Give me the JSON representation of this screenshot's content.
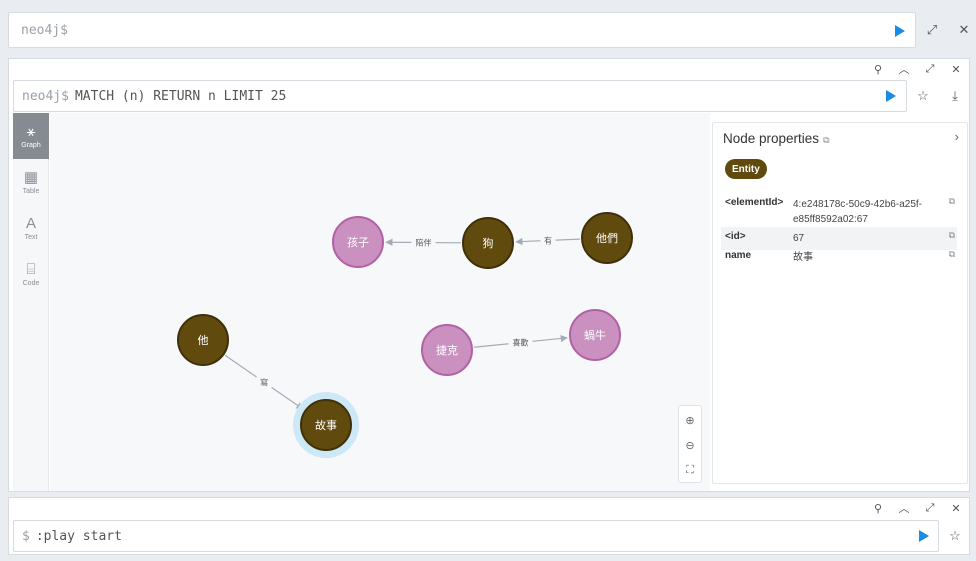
{
  "top_editor": {
    "prompt": "neo4j$",
    "query": ""
  },
  "result_frame": {
    "prompt": "neo4j$",
    "query": "MATCH (n) RETURN n LIMIT 25",
    "controls": [
      "pin-icon",
      "collapse-icon",
      "fullscreen-icon",
      "close-icon"
    ]
  },
  "sidebar": {
    "items": [
      {
        "label": "Graph",
        "icon": "graph-icon",
        "active": true
      },
      {
        "label": "Table",
        "icon": "table-icon",
        "active": false
      },
      {
        "label": "Text",
        "icon": "text-icon",
        "active": false
      },
      {
        "label": "Code",
        "icon": "code-icon",
        "active": false
      }
    ]
  },
  "graph": {
    "nodes": [
      {
        "id": "kid",
        "label": "孩子",
        "type": "pink"
      },
      {
        "id": "dog",
        "label": "狗",
        "type": "brown"
      },
      {
        "id": "they",
        "label": "他們",
        "type": "brown"
      },
      {
        "id": "he",
        "label": "他",
        "type": "brown"
      },
      {
        "id": "jack",
        "label": "捷克",
        "type": "pink"
      },
      {
        "id": "snail",
        "label": "蝸牛",
        "type": "pink"
      },
      {
        "id": "story",
        "label": "故事",
        "type": "brown",
        "selected": true
      }
    ],
    "edges": [
      {
        "from": "dog",
        "to": "kid",
        "label": "陪伴"
      },
      {
        "from": "they",
        "to": "dog",
        "label": "有"
      },
      {
        "from": "jack",
        "to": "snail",
        "label": "喜歡"
      },
      {
        "from": "he",
        "to": "story",
        "label": "寫"
      }
    ],
    "colors": {
      "brown": "#604a0e",
      "brown_stroke": "#3f300a",
      "pink": "#c990c0",
      "pink_stroke": "#b261a5",
      "selected_halo": "#cde8f7"
    }
  },
  "zoom_controls": [
    "zoom-in-icon",
    "zoom-out-icon",
    "fit-icon"
  ],
  "properties": {
    "title": "Node properties",
    "label_pill": "Entity",
    "rows": [
      {
        "key": "<elementId>",
        "value": "4:e248178c-50c9-42b6-a25f-e85ff8592a02:67"
      },
      {
        "key": "<id>",
        "value": "67"
      },
      {
        "key": "name",
        "value": "故事"
      }
    ]
  },
  "bottom_editor": {
    "prompt": "$",
    "query": ":play start"
  },
  "accent": "#1b8ce3"
}
